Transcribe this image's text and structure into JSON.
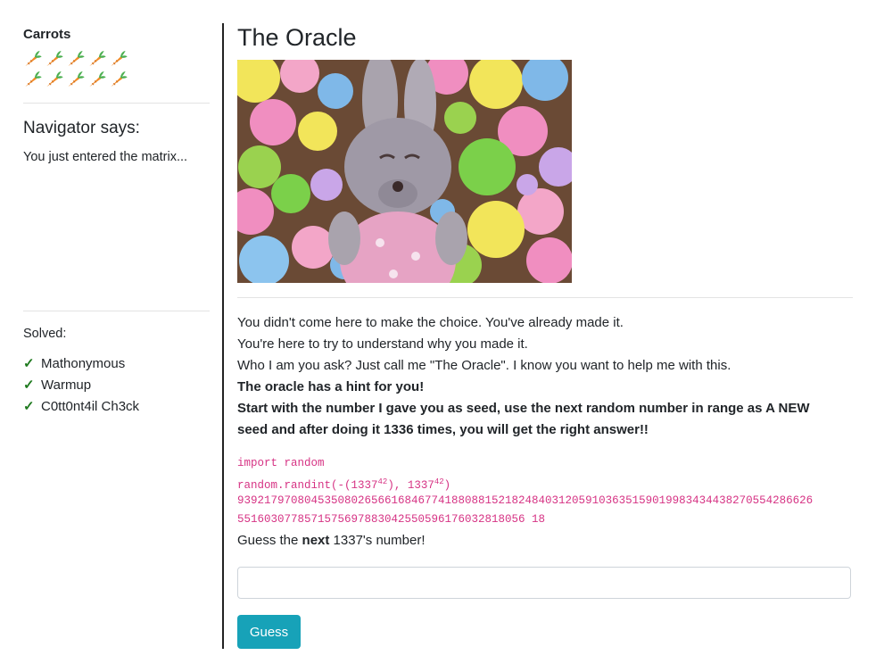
{
  "sidebar": {
    "carrots_title": "Carrots",
    "carrot_count": 10,
    "carrot_icon": "carrot-icon",
    "navigator_title": "Navigator says:",
    "navigator_text": "You just entered the matrix...",
    "solved_label": "Solved:",
    "solved_items": [
      "Mathonymous",
      "Warmup",
      "C0tt0nt4il Ch3ck"
    ],
    "check_icon": "✓",
    "check_color": "#1f7a1f"
  },
  "main": {
    "title": "The Oracle",
    "image_icon": "easter-bunny-pompoms-photo",
    "lines": [
      "You didn't come here to make the choice. You've already made it.",
      "You're here to try to understand why you made it.",
      "Who I am you ask? Just call me \"The Oracle\". I know you want to help me with this."
    ],
    "hint_bold_1": "The oracle has a hint for you!",
    "hint_bold_2a": "Start with the number I gave you as seed, use the next random number in range as A NEW",
    "hint_bold_2b": "seed and after doing it 1336 times, you will get the right answer!!",
    "code": {
      "line1": "import random",
      "line2_prefix": "random.randint(-(1337",
      "exp1": "42",
      "line2_middle": "), 1337",
      "exp2": "42",
      "line2_suffix": ")",
      "number_line1": "93921797080453508026566168467741880881521824840312059103635159019983434438270554286626",
      "number_line2": "5516030778571575697883042550596176032818056 18"
    },
    "guess_prefix": "Guess the ",
    "guess_bold": "next",
    "guess_suffix": " 1337's number!",
    "input_value": "",
    "button_label": "Guess",
    "accent_color": "#17a2b8",
    "code_color": "#d63384"
  }
}
